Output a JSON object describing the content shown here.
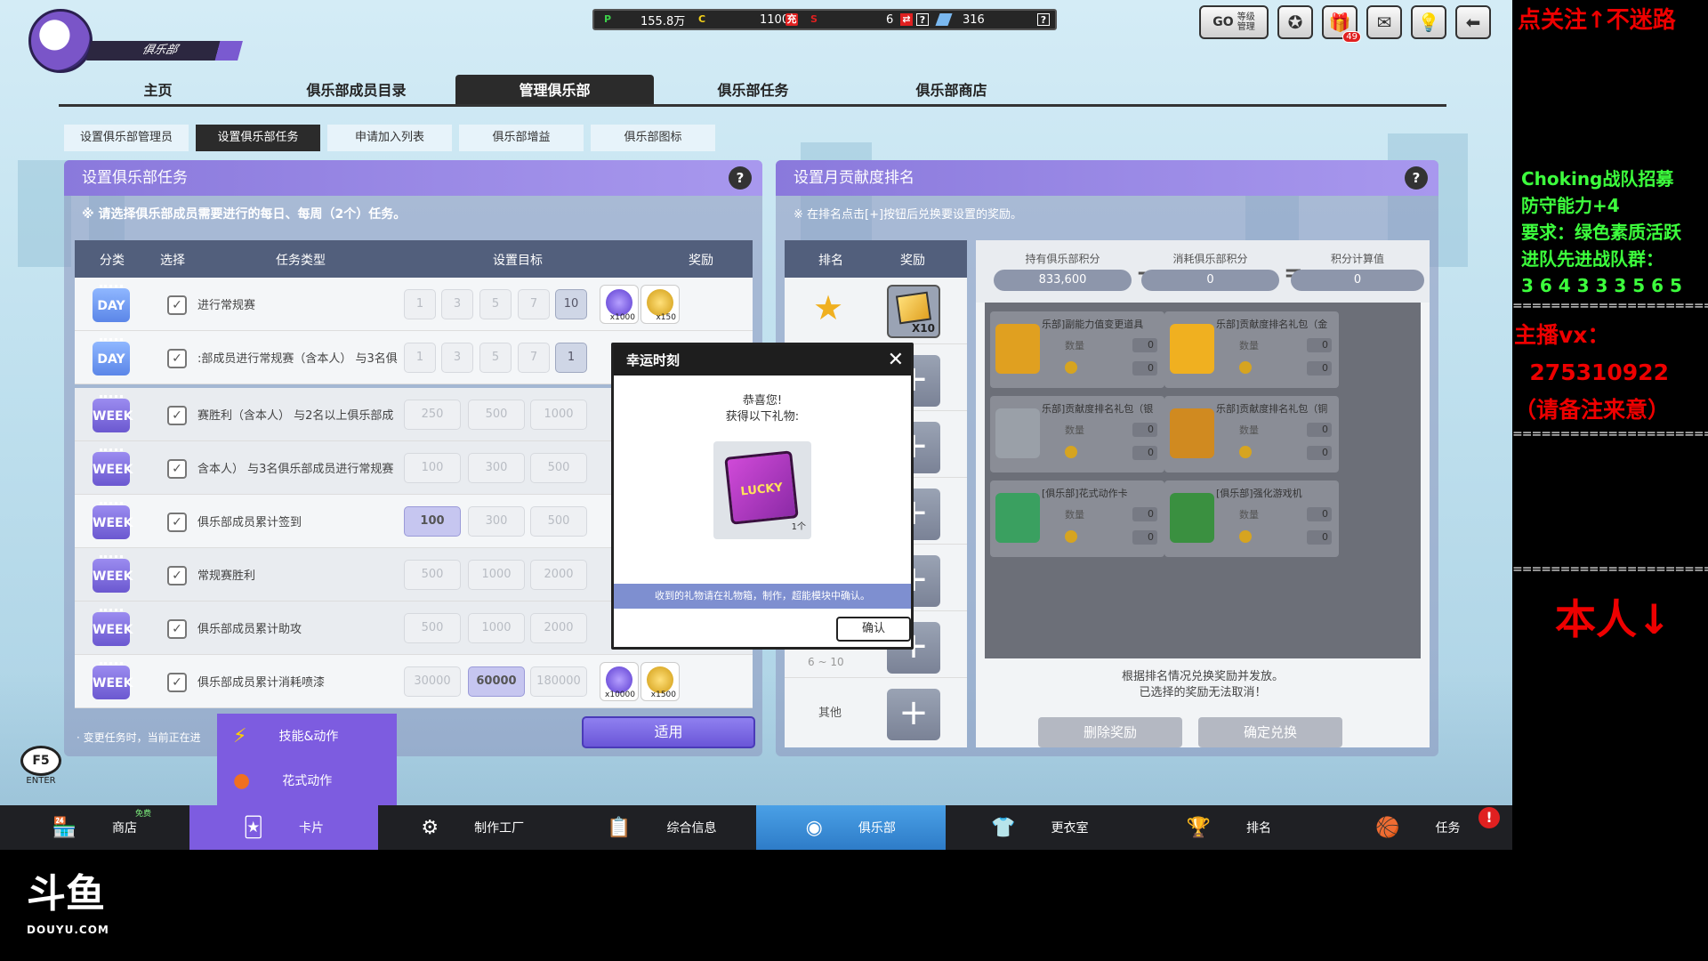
{
  "club": {
    "name": "俱乐部"
  },
  "currency": [
    {
      "icon": "P",
      "color": "#3dd04a",
      "value": "155.8万"
    },
    {
      "icon": "C",
      "color": "#f5d21a",
      "value": "1100"
    },
    {
      "icon": "充",
      "color": "#e02020",
      "value": ""
    },
    {
      "icon": "S",
      "color": "#e02020",
      "value": "6"
    },
    {
      "icon": "⇄",
      "color": "#e02020",
      "value": ""
    },
    {
      "icon": "?",
      "color": "#ffffff",
      "value": ""
    },
    {
      "icon": "ticket-icon",
      "color": "#7ab8f0",
      "value": "316"
    },
    {
      "icon": "?",
      "color": "#ffffff",
      "value": ""
    }
  ],
  "top_buttons": {
    "grade_label": "等级\n管理",
    "mail_badge": "49"
  },
  "main_tabs": [
    "主页",
    "俱乐部成员目录",
    "管理俱乐部",
    "俱乐部任务",
    "俱乐部商店"
  ],
  "sub_tabs": [
    "设置俱乐部管理员",
    "设置俱乐部任务",
    "申请加入列表",
    "俱乐部增益",
    "俱乐部图标"
  ],
  "left_panel": {
    "title": "设置俱乐部任务",
    "note": "※ 请选择俱乐部成员需要进行的每日、每周（2个）任务。",
    "headers": {
      "category": "分类",
      "select": "选择",
      "type": "任务类型",
      "target": "设置目标",
      "reward": "奖励"
    },
    "rows": [
      {
        "tag": "DAY",
        "name": "进行常规赛",
        "targets": [
          "1",
          "3",
          "5",
          "7",
          "10"
        ],
        "selected": 4,
        "rewards": [
          "x1000",
          "x150"
        ]
      },
      {
        "tag": "DAY",
        "name": ":部成员进行常规赛（含本人）  与3名俱",
        "targets": [
          "1",
          "3",
          "5",
          "7",
          "1"
        ],
        "selected": 4,
        "rewards": []
      },
      {
        "tag": "WEEK",
        "name": "赛胜利（含本人）  与2名以上俱乐部成",
        "targets": [
          "250",
          "500",
          "1000"
        ],
        "selected": -1,
        "rewards": []
      },
      {
        "tag": "WEEK",
        "name": "含本人）  与3名俱乐部成员进行常规赛",
        "targets": [
          "100",
          "300",
          "500"
        ],
        "selected": -1,
        "rewards": []
      },
      {
        "tag": "WEEK",
        "name": "俱乐部成员累计签到",
        "targets": [
          "100",
          "300",
          "500"
        ],
        "selected": 0,
        "rewards": []
      },
      {
        "tag": "WEEK",
        "name": "常规赛胜利",
        "targets": [
          "500",
          "1000",
          "2000"
        ],
        "selected": -1,
        "rewards": []
      },
      {
        "tag": "WEEK",
        "name": "俱乐部成员累计助攻",
        "targets": [
          "500",
          "1000",
          "2000"
        ],
        "selected": -1,
        "rewards": []
      },
      {
        "tag": "WEEK",
        "name": "俱乐部成员累计消耗喷漆",
        "targets": [
          "30000",
          "60000",
          "180000"
        ],
        "selected": 1,
        "rewards": [
          "x10000",
          "x1500"
        ]
      }
    ],
    "bottom_note": "· 变更任务时，当前正在进",
    "apply": "适用"
  },
  "right_panel": {
    "title": "设置月贡献度排名",
    "note": "※ 在排名点击[+]按钮后兑换要设置的奖励。",
    "rank_headers": {
      "rank": "排名",
      "reward": "奖励"
    },
    "first_reward_count": "X10",
    "rank_hidden_label": "6 ~ 10",
    "other_label": "其他",
    "calc": [
      {
        "label": "持有俱乐部积分",
        "value": "833,600"
      },
      {
        "label": "消耗俱乐部积分",
        "value": "0"
      },
      {
        "label": "积分计算值",
        "value": "0"
      }
    ],
    "items": [
      {
        "name": "乐部]副能力值变更道具",
        "qty_label": "数量",
        "qty": "0",
        "cost": "0",
        "color": "#e0a020"
      },
      {
        "name": "乐部]贡献度排名礼包（金",
        "qty_label": "数量",
        "qty": "0",
        "cost": "0",
        "color": "#f0b020"
      },
      {
        "name": "乐部]贡献度排名礼包（银",
        "qty_label": "数量",
        "qty": "0",
        "cost": "0",
        "color": "#9aa0a8"
      },
      {
        "name": "乐部]贡献度排名礼包（铜",
        "qty_label": "数量",
        "qty": "0",
        "cost": "0",
        "color": "#d08a20"
      },
      {
        "name": "[俱乐部]花式动作卡",
        "qty_label": "数量",
        "qty": "0",
        "cost": "0",
        "color": "#3aa060"
      },
      {
        "name": "[俱乐部]强化游戏机",
        "qty_label": "数量",
        "qty": "0",
        "cost": "0",
        "color": "#3a9040"
      }
    ],
    "footer_line1": "根据排名情况兑换奖励并发放。",
    "footer_line2": "已选择的奖励无法取消！",
    "delete_btn": "删除奖励",
    "confirm_btn": "确定兑换"
  },
  "modal": {
    "title": "幸运时刻",
    "line1": "恭喜您!",
    "line2": "获得以下礼物:",
    "gift_label": "LUCKY",
    "gift_count": "1个",
    "footer": "收到的礼物请在礼物箱，制作，超能模块中确认。",
    "ok": "确认"
  },
  "popup_menu": [
    "技能&动作",
    "花式动作"
  ],
  "f5": {
    "key": "F5",
    "label": "ENTER"
  },
  "bottom_bar": [
    {
      "label": "商店",
      "extra": "免费"
    },
    {
      "label": "卡片"
    },
    {
      "label": "制作工厂"
    },
    {
      "label": "综合信息"
    },
    {
      "label": "俱乐部"
    },
    {
      "label": "更衣室"
    },
    {
      "label": "排名"
    },
    {
      "label": "任务"
    }
  ],
  "side": {
    "top": "点关注↑不迷路",
    "recruit": "Choking战队招募\n防守能力+4\n要求：绿色素质活跃\n进队先进战队群：\n3 6 4 3 3 3 5 6 5",
    "vx": "主播vx：\n  275310922\n（请备注来意）",
    "self": "本人↓",
    "dashes": "========================="
  },
  "watermark": {
    "main": "斗鱼",
    "sub": "DOUYU.COM"
  }
}
